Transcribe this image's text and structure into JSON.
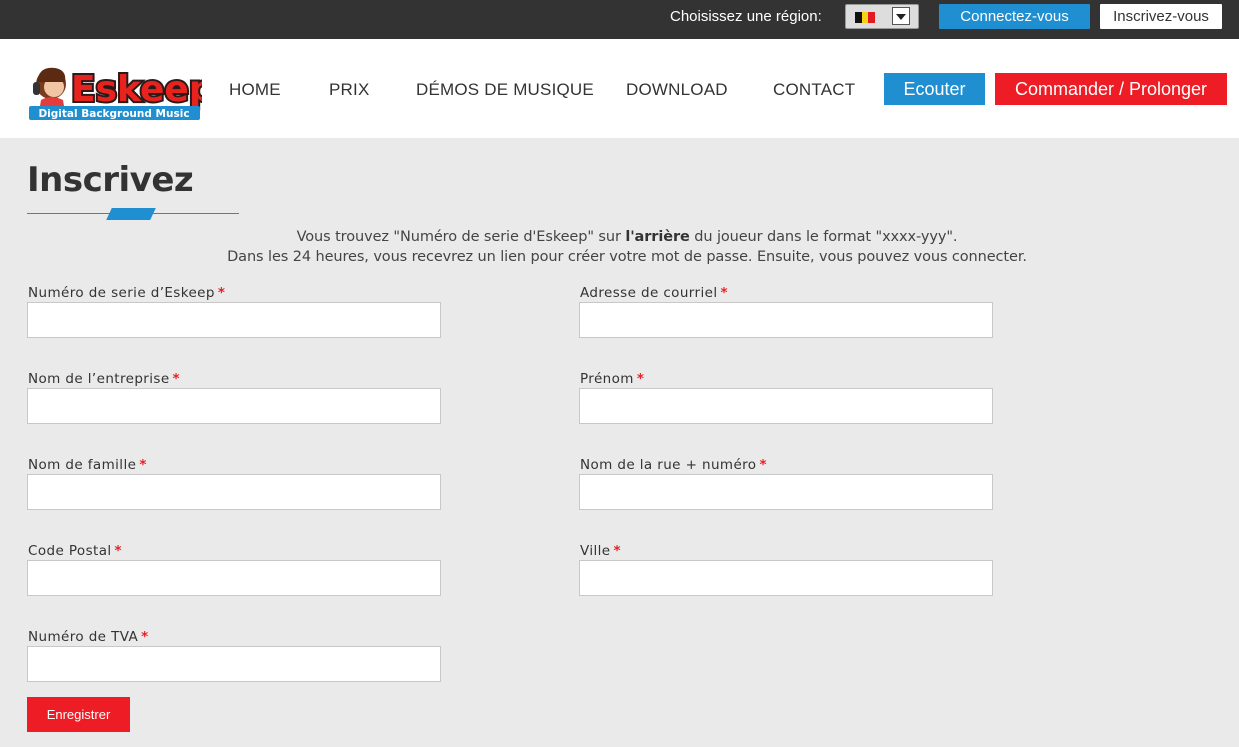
{
  "topbar": {
    "region_label": "Choisissez une région:",
    "region_value": "Belgique",
    "login_button": "Connectez-vous",
    "register_button": "Inscrivez-vous"
  },
  "header": {
    "logo_name": "Eskeep",
    "logo_tagline": "Digital Background Music",
    "nav": [
      "HOME",
      "PRIX",
      "DÉMOS DE MUSIQUE",
      "DOWNLOAD",
      "CONTACT"
    ],
    "listen_button": "Ecouter",
    "order_button": "Commander / Prolonger"
  },
  "page": {
    "title": "Inscrivez",
    "intro_line1_before": "Vous trouvez \"Numéro de serie d'Eskeep\" sur ",
    "intro_line1_bold": "l'arrière",
    "intro_line1_after": " du joueur dans le format \"xxxx-yyy\".",
    "intro_line2": "Dans les 24 heures, vous recevrez un lien pour créer votre mot de passe. Ensuite, vous pouvez vous connecter."
  },
  "form": {
    "fields": [
      {
        "label": "Numéro de serie d’Eskeep",
        "value": "",
        "required": true
      },
      {
        "label": "Adresse de courriel",
        "value": "",
        "required": true
      },
      {
        "label": "Nom de l’entreprise",
        "value": "",
        "required": true
      },
      {
        "label": "Prénom",
        "value": "",
        "required": true
      },
      {
        "label": "Nom de famille",
        "value": "",
        "required": true
      },
      {
        "label": "Nom de la rue + numéro",
        "value": "",
        "required": true
      },
      {
        "label": "Code Postal",
        "value": "",
        "required": true
      },
      {
        "label": "Ville",
        "value": "",
        "required": true
      },
      {
        "label": "Numéro de TVA",
        "value": "",
        "required": true
      }
    ],
    "required_marker": "*",
    "submit_label": "Enregistrer"
  },
  "colors": {
    "topbar_bg": "#333333",
    "accent_blue": "#1f8fd1",
    "accent_red": "#ee1c25",
    "page_bg": "#eaeaea"
  },
  "icons": {
    "region_flag": "belgium-flag-icon",
    "region_dropdown": "chevron-down-icon"
  }
}
